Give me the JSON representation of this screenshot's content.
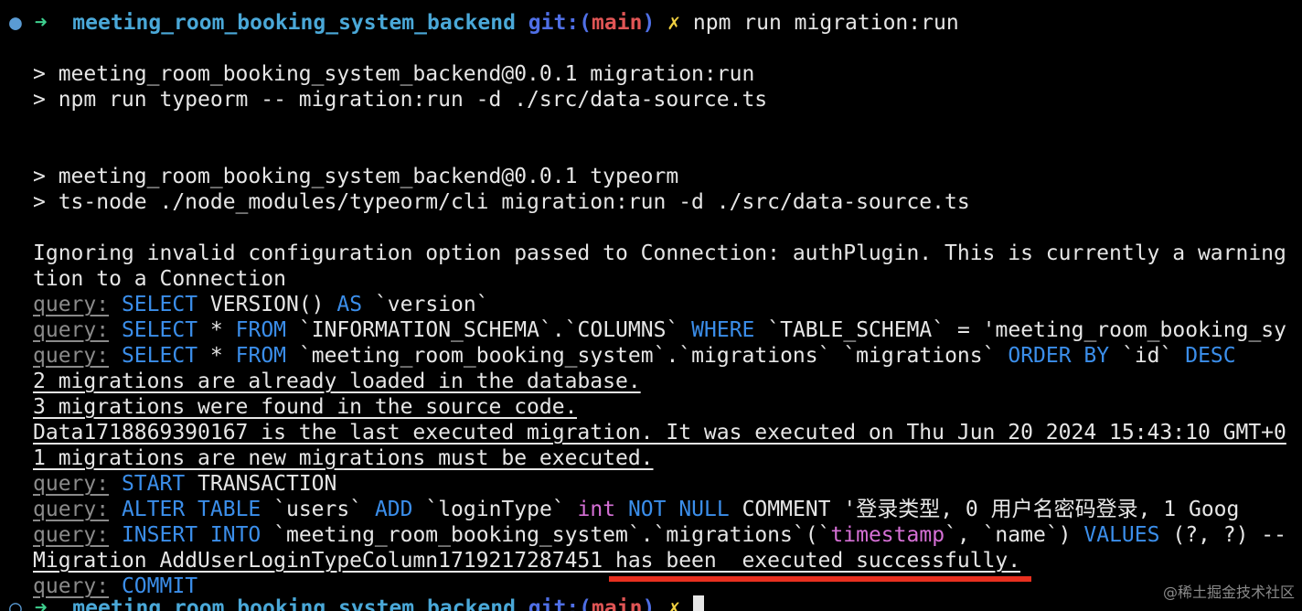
{
  "prompt": {
    "dot": "●",
    "arrow": "➜",
    "directory": "meeting_room_booking_system_backend",
    "git_open": "git:(",
    "branch": "main",
    "git_close": ")",
    "dirty": "✗",
    "command": "npm run migration:run"
  },
  "npm_header_1": {
    "line1": "> meeting_room_booking_system_backend@0.0.1 migration:run",
    "line2": "> npm run typeorm -- migration:run -d ./src/data-source.ts"
  },
  "npm_header_2": {
    "line1": "> meeting_room_booking_system_backend@0.0.1 typeorm",
    "line2": "> ts-node ./node_modules/typeorm/cli migration:run -d ./src/data-source.ts"
  },
  "warning": {
    "line1": "Ignoring invalid configuration option passed to Connection: authPlugin. This is currently a warning",
    "line2": "tion to a Connection"
  },
  "query_label": "query:",
  "log": {
    "q1": {
      "kw1": "SELECT",
      "t1": "VERSION()",
      "kw2": "AS",
      "t2": "`version`"
    },
    "q2": {
      "kw1": "SELECT",
      "t1": "*",
      "kw2": "FROM",
      "t2": "`INFORMATION_SCHEMA`.`COLUMNS`",
      "kw3": "WHERE",
      "t3": "`TABLE_SCHEMA` = 'meeting_room_booking_sy"
    },
    "q3": {
      "kw1": "SELECT",
      "t1": "*",
      "kw2": "FROM",
      "t2": "`meeting_room_booking_system`.`migrations` `migrations`",
      "kw3": "ORDER BY",
      "t3": "`id`",
      "kw4": "DESC"
    },
    "m1": "2 migrations are already loaded in the database.",
    "m2": "3 migrations were found in the source code.",
    "m3": "Data1718869390167 is the last executed migration. It was executed on Thu Jun 20 2024 15:43:10 GMT+0",
    "m4": "1 migrations are new migrations must be executed.",
    "q4": {
      "kw1": "START",
      "t1": "TRANSACTION"
    },
    "q5": {
      "kw1": "ALTER TABLE",
      "t1": "`users`",
      "kw2": "ADD",
      "t2": "`loginType`",
      "type": "int",
      "kw3": "NOT NULL",
      "t3": "COMMENT '登录类型, 0 用户名密码登录, 1 Goog"
    },
    "q6": {
      "kw1": "INSERT INTO",
      "t1": "`meeting_room_booking_system`.`migrations`(`",
      "hl": "timestamp",
      "t2": "`, `name`)",
      "kw2": "VALUES",
      "t3": "(?, ?) --"
    },
    "success": "Migration AddUserLoginTypeColumn1719217287451 has been  executed successfully.",
    "q7": {
      "kw1": "COMMIT"
    }
  },
  "prompt2": {
    "dot": "○",
    "arrow": "➜",
    "directory": "meeting_room_booking_system_backend",
    "git_open": "git:(",
    "branch": "main",
    "git_close": ")",
    "dirty": "✗"
  },
  "watermark": "@稀土掘金技术社区",
  "colors": {
    "background": "#000000",
    "text": "#e6e6e6",
    "keyword": "#3b8eea",
    "query_label": "#8a8a8a",
    "directory": "#4aa8d8",
    "branch": "#e05555",
    "dirty_mark": "#f0d040",
    "highlight_underline": "#e8301f"
  }
}
